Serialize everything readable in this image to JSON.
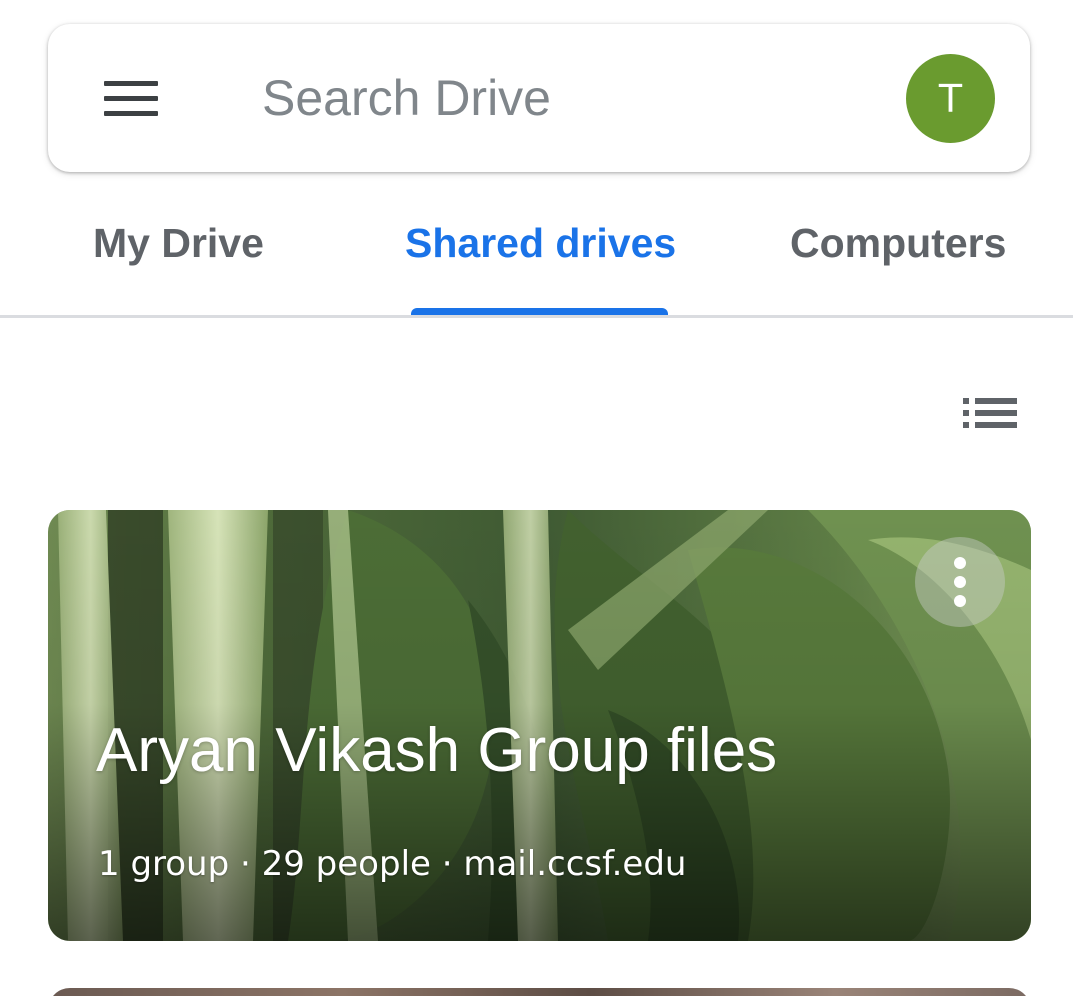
{
  "search": {
    "placeholder": "Search Drive",
    "menu_icon": "hamburger-menu-icon"
  },
  "account": {
    "initial": "T",
    "avatar_color": "#6a9b2f"
  },
  "tabs": [
    {
      "label": "My Drive",
      "active": false
    },
    {
      "label": "Shared drives",
      "active": true
    },
    {
      "label": "Computers",
      "active": false
    }
  ],
  "colors": {
    "accent": "#1a73e8",
    "text_secondary": "#5f6368",
    "divider": "#dadce0"
  },
  "view_toggle": {
    "icon": "list-view-icon"
  },
  "shared_drives": [
    {
      "name": "Aryan Vikash Group files",
      "details": "1 group · 29 people · mail.ccsf.edu",
      "theme_image": "leafy-greens-photo",
      "more_icon": "more-vert-icon"
    }
  ]
}
